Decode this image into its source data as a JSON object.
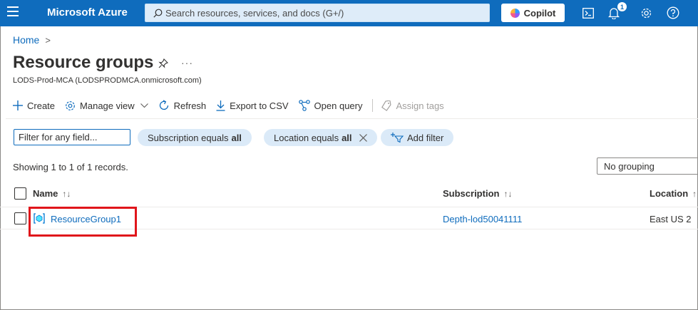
{
  "topbar": {
    "brand": "Microsoft Azure",
    "search_placeholder": "Search resources, services, and docs (G+/)",
    "copilot_label": "Copilot",
    "notification_count": "1"
  },
  "breadcrumb": {
    "home": "Home",
    "separator": ">"
  },
  "page": {
    "title": "Resource groups",
    "subtitle": "LODS-Prod-MCA (LODSPRODMCA.onmicrosoft.com)",
    "more": "···"
  },
  "toolbar": {
    "create": "Create",
    "manage_view": "Manage view",
    "refresh": "Refresh",
    "export": "Export to CSV",
    "open_query": "Open query",
    "assign_tags": "Assign tags"
  },
  "filters": {
    "placeholder": "Filter for any field...",
    "subscription_prefix": "Subscription equals",
    "subscription_value": "all",
    "location_prefix": "Location equals",
    "location_value": "all",
    "add_filter": "Add filter"
  },
  "records_text": "Showing 1 to 1 of 1 records.",
  "grouping": "No grouping",
  "table": {
    "columns": {
      "name": "Name",
      "subscription": "Subscription",
      "location": "Location"
    },
    "sort_name": "↑↓",
    "sort_subscription": "↑↓",
    "sort_location": "↑",
    "rows": [
      {
        "name": "ResourceGroup1",
        "subscription": "Depth-lod50041111",
        "location": "East US 2"
      }
    ]
  },
  "colors": {
    "accent": "#0f6cbd",
    "highlight": "#e0151b",
    "pill": "#dbeaf8"
  }
}
